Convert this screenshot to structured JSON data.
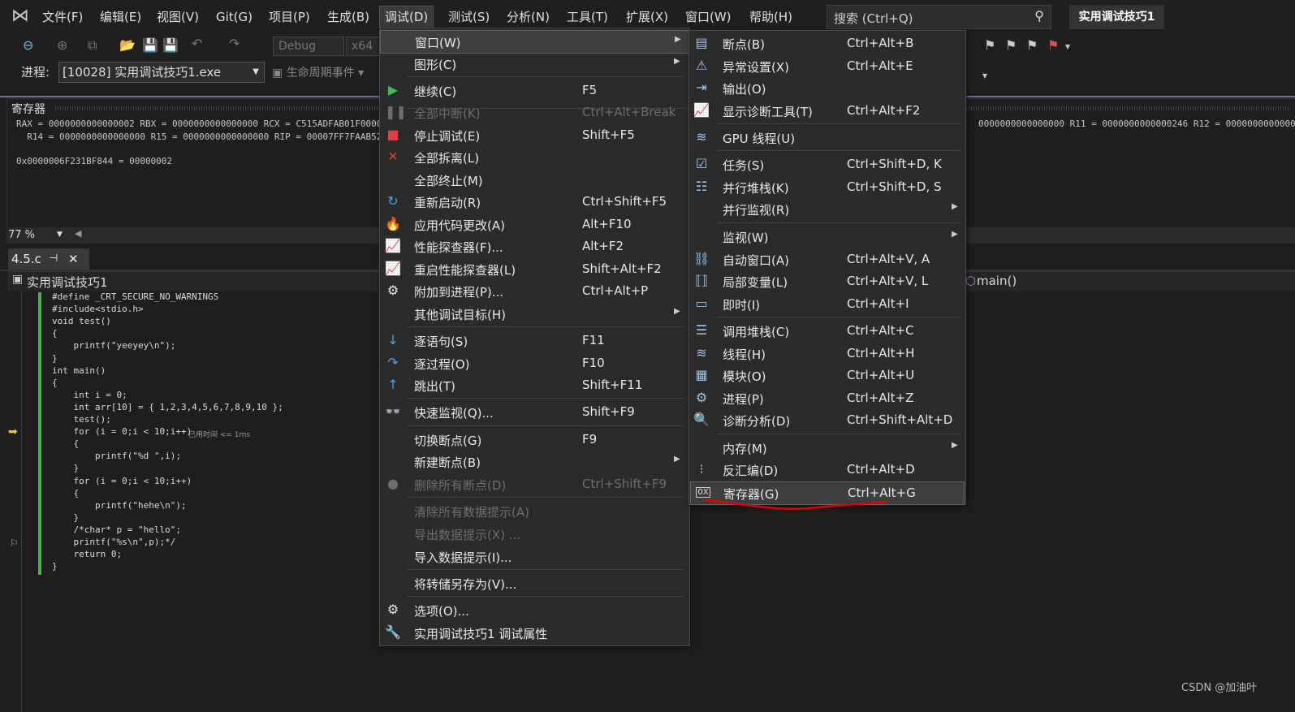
{
  "menubar": {
    "items": [
      "文件(F)",
      "编辑(E)",
      "视图(V)",
      "Git(G)",
      "项目(P)",
      "生成(B)",
      "调试(D)",
      "测试(S)",
      "分析(N)",
      "工具(T)",
      "扩展(X)",
      "窗口(W)",
      "帮助(H)"
    ],
    "search_placeholder": "搜索 (Ctrl+Q)",
    "solution_name": "实用调试技巧1"
  },
  "toolbar": {
    "config": "Debug",
    "platform": "x64",
    "process_label": "进程:",
    "process_value": "[10028] 实用调试技巧1.exe",
    "lifecycle": "生命周期事件"
  },
  "registers": {
    "title": "寄存器",
    "line1": "RAX = 0000000000000002 RBX = 0000000000000000 RCX = C515ADFAB01F0000 RDX",
    "line1_right": "0000000000000000 R11 = 0000000000000246 R12 = 0000000000000000",
    "line2": "  R14 = 0000000000000000 R15 = 0000000000000000 RIP = 00007FF7FAAB5237 RS",
    "line3": "0x0000006F231BF844 = 00000002",
    "zoom": "77 %"
  },
  "editor": {
    "tab": "4.5.c",
    "nav_project": "实用调试技巧1",
    "nav_func": "main()",
    "lines": [
      "#define _CRT_SECURE_NO_WARNINGS",
      "#include<stdio.h>",
      "void test()",
      "{",
      "    printf(\"yeeyey\\n\");",
      "}",
      "int main()",
      "{",
      "    int i = 0;",
      "    int arr[10] = { 1,2,3,4,5,6,7,8,9,10 };",
      "    test();",
      "    for (i = 0;i < 10;i++)",
      "    {",
      "        printf(\"%d \",i);",
      "    }",
      "    for (i = 0;i < 10;i++)",
      "    {",
      "        printf(\"hehe\\n\");",
      "    }",
      "    /*char* p = \"hello\";",
      "    printf(\"%s\\n\",p);*/",
      "    return 0;",
      "}"
    ],
    "elapsed": "已用时间 <= 1ms"
  },
  "debug_menu": {
    "items": [
      {
        "label": "窗口(W)",
        "shortcut": "",
        "sub": true,
        "icon": "",
        "disabled": false
      },
      {
        "label": "图形(C)",
        "shortcut": "",
        "sub": true,
        "icon": "",
        "disabled": false
      },
      {
        "label": "继续(C)",
        "shortcut": "F5",
        "sub": false,
        "icon": "▶",
        "disabled": false
      },
      {
        "label": "全部中断(K)",
        "shortcut": "Ctrl+Alt+Break",
        "sub": false,
        "icon": "❚❚",
        "disabled": true
      },
      {
        "label": "停止调试(E)",
        "shortcut": "Shift+F5",
        "sub": false,
        "icon": "■",
        "disabled": false
      },
      {
        "label": "全部拆离(L)",
        "shortcut": "",
        "sub": false,
        "icon": "✕",
        "disabled": false
      },
      {
        "label": "全部终止(M)",
        "shortcut": "",
        "sub": false,
        "icon": "",
        "disabled": false
      },
      {
        "label": "重新启动(R)",
        "shortcut": "Ctrl+Shift+F5",
        "sub": false,
        "icon": "↻",
        "disabled": false
      },
      {
        "label": "应用代码更改(A)",
        "shortcut": "Alt+F10",
        "sub": false,
        "icon": "🔥",
        "disabled": false
      },
      {
        "label": "性能探查器(F)...",
        "shortcut": "Alt+F2",
        "sub": false,
        "icon": "📈",
        "disabled": false
      },
      {
        "label": "重启性能探查器(L)",
        "shortcut": "Shift+Alt+F2",
        "sub": false,
        "icon": "📈",
        "disabled": false
      },
      {
        "label": "附加到进程(P)...",
        "shortcut": "Ctrl+Alt+P",
        "sub": false,
        "icon": "⚙",
        "disabled": false
      },
      {
        "label": "其他调试目标(H)",
        "shortcut": "",
        "sub": true,
        "icon": "",
        "disabled": false
      },
      {
        "label": "逐语句(S)",
        "shortcut": "F11",
        "sub": false,
        "icon": "↓",
        "disabled": false
      },
      {
        "label": "逐过程(O)",
        "shortcut": "F10",
        "sub": false,
        "icon": "↷",
        "disabled": false
      },
      {
        "label": "跳出(T)",
        "shortcut": "Shift+F11",
        "sub": false,
        "icon": "↑",
        "disabled": false
      },
      {
        "label": "快速监视(Q)...",
        "shortcut": "Shift+F9",
        "sub": false,
        "icon": "👓",
        "disabled": false
      },
      {
        "label": "切换断点(G)",
        "shortcut": "F9",
        "sub": false,
        "icon": "",
        "disabled": false
      },
      {
        "label": "新建断点(B)",
        "shortcut": "",
        "sub": true,
        "icon": "",
        "disabled": false
      },
      {
        "label": "删除所有断点(D)",
        "shortcut": "Ctrl+Shift+F9",
        "sub": false,
        "icon": "●",
        "disabled": true
      },
      {
        "label": "清除所有数据提示(A)",
        "shortcut": "",
        "sub": false,
        "icon": "",
        "disabled": true
      },
      {
        "label": "导出数据提示(X) ...",
        "shortcut": "",
        "sub": false,
        "icon": "",
        "disabled": true
      },
      {
        "label": "导入数据提示(I)...",
        "shortcut": "",
        "sub": false,
        "icon": "",
        "disabled": false
      },
      {
        "label": "将转储另存为(V)...",
        "shortcut": "",
        "sub": false,
        "icon": "",
        "disabled": false
      },
      {
        "label": "选项(O)...",
        "shortcut": "",
        "sub": false,
        "icon": "⚙",
        "disabled": false
      },
      {
        "label": "实用调试技巧1 调试属性",
        "shortcut": "",
        "sub": false,
        "icon": "🔧",
        "disabled": false
      }
    ]
  },
  "window_submenu": {
    "items": [
      {
        "label": "断点(B)",
        "shortcut": "Ctrl+Alt+B",
        "sub": false,
        "icon": "▤"
      },
      {
        "label": "异常设置(X)",
        "shortcut": "Ctrl+Alt+E",
        "sub": false,
        "icon": "⚠"
      },
      {
        "label": "输出(O)",
        "shortcut": "",
        "sub": false,
        "icon": "⇥"
      },
      {
        "label": "显示诊断工具(T)",
        "shortcut": "Ctrl+Alt+F2",
        "sub": false,
        "icon": "📈"
      },
      {
        "label": "GPU 线程(U)",
        "shortcut": "",
        "sub": false,
        "icon": "≋"
      },
      {
        "label": "任务(S)",
        "shortcut": "Ctrl+Shift+D, K",
        "sub": false,
        "icon": "☑"
      },
      {
        "label": "并行堆栈(K)",
        "shortcut": "Ctrl+Shift+D, S",
        "sub": false,
        "icon": "☷"
      },
      {
        "label": "并行监视(R)",
        "shortcut": "",
        "sub": true,
        "icon": ""
      },
      {
        "label": "监视(W)",
        "shortcut": "",
        "sub": true,
        "icon": ""
      },
      {
        "label": "自动窗口(A)",
        "shortcut": "Ctrl+Alt+V, A",
        "sub": false,
        "icon": "⛓"
      },
      {
        "label": "局部变量(L)",
        "shortcut": "Ctrl+Alt+V, L",
        "sub": false,
        "icon": "⟦⟧"
      },
      {
        "label": "即时(I)",
        "shortcut": "Ctrl+Alt+I",
        "sub": false,
        "icon": "▭"
      },
      {
        "label": "调用堆栈(C)",
        "shortcut": "Ctrl+Alt+C",
        "sub": false,
        "icon": "☰"
      },
      {
        "label": "线程(H)",
        "shortcut": "Ctrl+Alt+H",
        "sub": false,
        "icon": "≋"
      },
      {
        "label": "模块(O)",
        "shortcut": "Ctrl+Alt+U",
        "sub": false,
        "icon": "▦"
      },
      {
        "label": "进程(P)",
        "shortcut": "Ctrl+Alt+Z",
        "sub": false,
        "icon": "⚙"
      },
      {
        "label": "诊断分析(D)",
        "shortcut": "Ctrl+Shift+Alt+D",
        "sub": false,
        "icon": "🔍"
      },
      {
        "label": "内存(M)",
        "shortcut": "",
        "sub": true,
        "icon": ""
      },
      {
        "label": "反汇编(D)",
        "shortcut": "Ctrl+Alt+D",
        "sub": false,
        "icon": "⁝"
      },
      {
        "label": "寄存器(G)",
        "shortcut": "Ctrl+Alt+G",
        "sub": false,
        "icon": "0X"
      }
    ]
  },
  "watermark": "CSDN @加油叶",
  "colors": {
    "accent": "#7c5fc3",
    "annotation": "#e00000",
    "changebar": "#4caf50"
  }
}
